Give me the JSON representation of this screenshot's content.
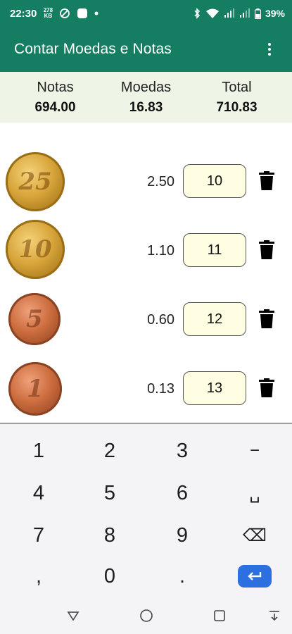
{
  "status_bar": {
    "time": "22:30",
    "notif_top": "278",
    "notif_bottom": "KB",
    "battery": "39%"
  },
  "app": {
    "title": "Contar Moedas e Notas",
    "accent_color": "#157d62"
  },
  "summary": {
    "notes_label": "Notas",
    "notes_value": "694.00",
    "coins_label": "Moedas",
    "coins_value": "16.83",
    "total_label": "Total",
    "total_value": "710.83"
  },
  "rows": [
    {
      "coin": "25",
      "price": "2.50",
      "qty": "10",
      "color": "gold"
    },
    {
      "coin": "10",
      "price": "1.10",
      "qty": "11",
      "color": "gold"
    },
    {
      "coin": "5",
      "price": "0.60",
      "qty": "12",
      "color": "copper"
    },
    {
      "coin": "1",
      "price": "0.13",
      "qty": "13",
      "color": "copper"
    }
  ],
  "keyboard": {
    "keys": [
      "1",
      "2",
      "3",
      "−",
      "4",
      "5",
      "6",
      "␣",
      "7",
      "8",
      "9",
      "⌫",
      ",",
      "0",
      "."
    ]
  }
}
